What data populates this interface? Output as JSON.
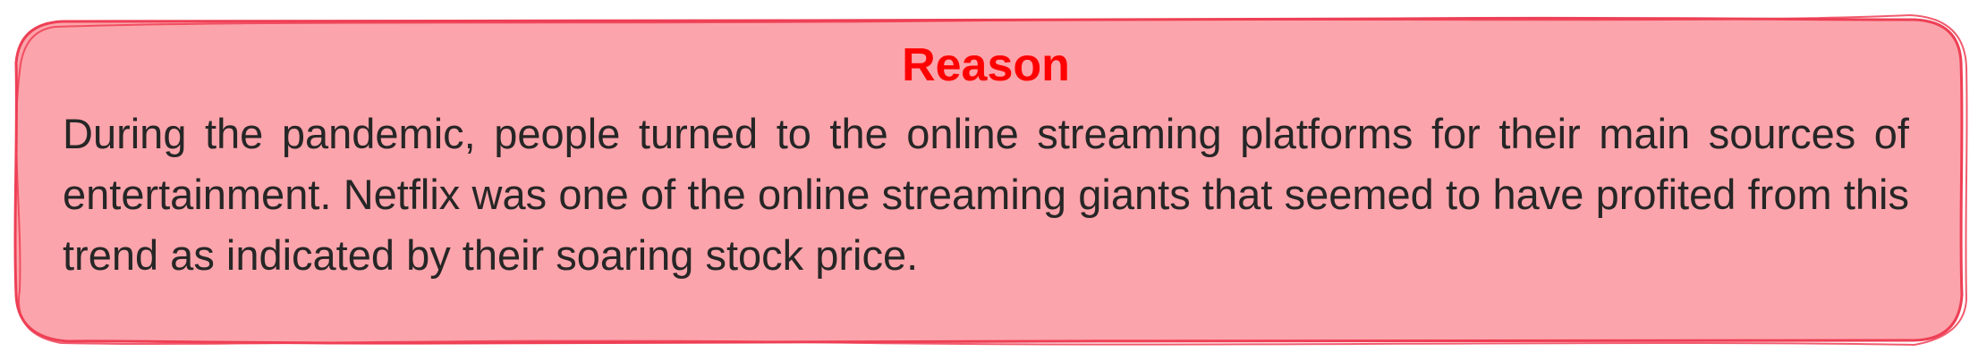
{
  "callout": {
    "title": "Reason",
    "body": "During the pandemic, people turned to the online streaming platforms for their main sources of entertainment. Netflix was one of the online streaming giants that seemed to have profited from this trend as indicated by their soaring stock price."
  },
  "colors": {
    "fill": "#fca4ab",
    "border": "#ee3f55",
    "title": "#ff0000",
    "text": "#262626"
  }
}
